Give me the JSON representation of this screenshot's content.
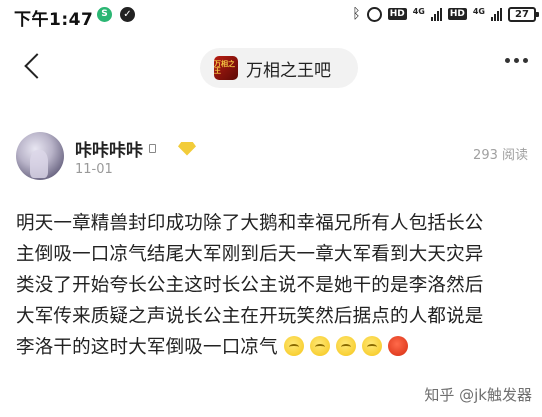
{
  "status_bar": {
    "time": "下午1:47",
    "notif1": "S",
    "notif2": "✓",
    "hd1": "HD",
    "net1": "4G",
    "hd2": "HD",
    "net2": "4G",
    "battery": "27"
  },
  "nav": {
    "forum_logo_text": "万相之王",
    "forum_name": "万相之王吧"
  },
  "post": {
    "author": "咔咔咔咔",
    "date": "11-01",
    "views": "293 阅读",
    "lines": [
      "明天一章精兽封印成功除了大鹅和幸福兄所有人包括长公",
      "主倒吸一口凉气结尾大军刚到后天一章大军看到大天灾异",
      "类没了开始夸长公主这时长公主说不是她干的是李洛然后",
      "大军传来质疑之声说长公主在开玩笑然后据点的人都说是",
      "李洛干的这时大军倒吸一口凉气"
    ],
    "emojis": [
      "smile-emoji",
      "smile-emoji",
      "smile-emoji",
      "smile-emoji",
      "angry-emoji"
    ]
  },
  "watermark": "知乎 @jk触发器",
  "colors": {
    "forum_logo": "#b81d12",
    "badge": "#f2cc3a",
    "text": "#222222",
    "muted": "#9a9a9a"
  }
}
